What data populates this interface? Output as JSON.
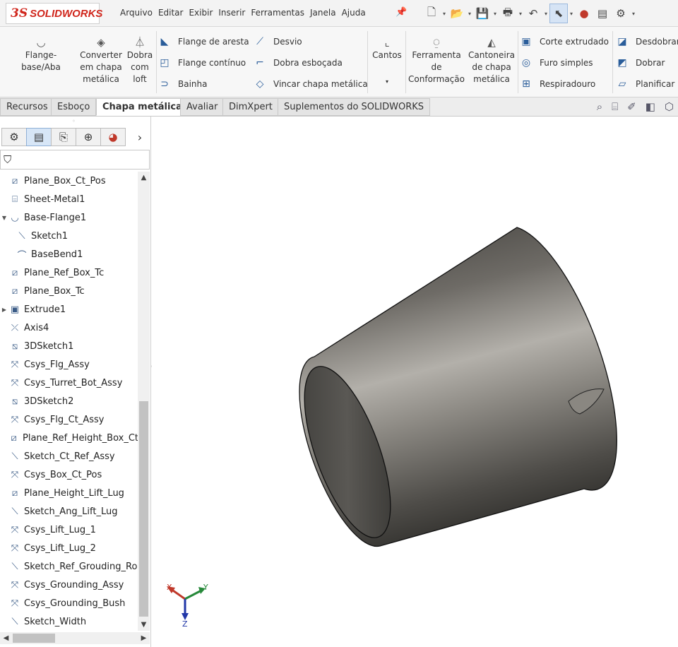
{
  "app": {
    "logo_mark": "3S",
    "logo_name": "SOLIDWORKS"
  },
  "menu": [
    "Arquivo",
    "Editar",
    "Exibir",
    "Inserir",
    "Ferramentas",
    "Janela",
    "Ajuda"
  ],
  "quick_access_icons": [
    "new-document-icon",
    "open-icon",
    "save-icon",
    "print-icon",
    "undo-icon",
    "select-icon",
    "rebuild-icon",
    "file-properties-icon",
    "options-icon"
  ],
  "ribbon": {
    "big_buttons": [
      {
        "name": "flange-base-aba",
        "label": "Flange-base/Aba",
        "icon": "base-flange-icon"
      },
      {
        "name": "converter-chapa",
        "label": "Converter em chapa metálica",
        "icon": "convert-to-sheet-metal-icon"
      },
      {
        "name": "dobra-com-loft",
        "label": "Dobra com loft",
        "icon": "lofted-bend-icon"
      },
      {
        "name": "cantos",
        "label": "Cantos",
        "icon": "corners-icon"
      },
      {
        "name": "ferramenta-conformacao",
        "label": "Ferramenta de Conformação",
        "icon": "forming-tool-icon"
      },
      {
        "name": "cantoneira",
        "label": "Cantoneira de chapa metálica",
        "icon": "sheet-metal-gusset-icon"
      }
    ],
    "col1": [
      "Flange de aresta",
      "Flange contínuo",
      "Bainha"
    ],
    "col2": [
      "Desvio",
      "Dobra esboçada",
      "Vincar chapa metálica"
    ],
    "col3": [
      "Corte extrudado",
      "Furo simples",
      "Respiradouro"
    ],
    "col4": [
      "Desdobrar",
      "Dobrar",
      "Planificar"
    ]
  },
  "tabs": [
    "Recursos",
    "Esboço",
    "Chapa metálica",
    "Avaliar",
    "DimXpert",
    "Suplementos do SOLIDWORKS"
  ],
  "active_tab": "Chapa metálica",
  "view_icons": [
    "zoom-to-fit-icon",
    "zoom-to-area-icon",
    "previous-view-icon",
    "section-view-icon",
    "view-orientation-icon"
  ],
  "panel_tabs": [
    "feature-manager-icon",
    "property-manager-icon",
    "configuration-manager-icon",
    "dimxpert-manager-icon",
    "display-manager-icon"
  ],
  "tree": [
    {
      "label": "Plane_Box_Ct_Pos",
      "icon": "plane-icon",
      "indent": 0
    },
    {
      "label": "Sheet-Metal1",
      "icon": "sheet-metal-icon",
      "indent": 0
    },
    {
      "label": "Base-Flange1",
      "icon": "base-flange-icon",
      "indent": 0,
      "expanded": true
    },
    {
      "label": "Sketch1",
      "icon": "sketch-icon",
      "indent": 1
    },
    {
      "label": "BaseBend1",
      "icon": "bend-icon",
      "indent": 1
    },
    {
      "label": "Plane_Ref_Box_Tc",
      "icon": "plane-icon",
      "indent": 0
    },
    {
      "label": "Plane_Box_Tc",
      "icon": "plane-icon",
      "indent": 0
    },
    {
      "label": "Extrude1",
      "icon": "extrude-icon",
      "indent": 0,
      "collapsed": true
    },
    {
      "label": "Axis4",
      "icon": "axis-icon",
      "indent": 0
    },
    {
      "label": "3DSketch1",
      "icon": "sketch3d-icon",
      "indent": 0
    },
    {
      "label": "Csys_Flg_Assy",
      "icon": "csys-icon",
      "indent": 0
    },
    {
      "label": "Csys_Turret_Bot_Assy",
      "icon": "csys-icon",
      "indent": 0
    },
    {
      "label": "3DSketch2",
      "icon": "sketch3d-icon",
      "indent": 0
    },
    {
      "label": "Csys_Flg_Ct_Assy",
      "icon": "csys-icon",
      "indent": 0
    },
    {
      "label": "Plane_Ref_Height_Box_Ct",
      "icon": "plane-icon",
      "indent": 0
    },
    {
      "label": "Sketch_Ct_Ref_Assy",
      "icon": "sketch-icon",
      "indent": 0
    },
    {
      "label": "Csys_Box_Ct_Pos",
      "icon": "csys-icon",
      "indent": 0
    },
    {
      "label": "Plane_Height_Lift_Lug",
      "icon": "plane-icon",
      "indent": 0
    },
    {
      "label": "Sketch_Ang_Lift_Lug",
      "icon": "sketch-icon",
      "indent": 0
    },
    {
      "label": "Csys_Lift_Lug_1",
      "icon": "csys-icon",
      "indent": 0
    },
    {
      "label": "Csys_Lift_Lug_2",
      "icon": "csys-icon",
      "indent": 0
    },
    {
      "label": "Sketch_Ref_Grouding_Ro",
      "icon": "sketch-icon",
      "indent": 0
    },
    {
      "label": "Csys_Grounding_Assy",
      "icon": "csys-icon",
      "indent": 0
    },
    {
      "label": "Csys_Grounding_Bush",
      "icon": "csys-icon",
      "indent": 0
    },
    {
      "label": "Sketch_Width",
      "icon": "sketch-icon",
      "indent": 0
    }
  ],
  "triad": {
    "x": "X",
    "y": "Y",
    "z": "Z"
  },
  "colors": {
    "brand": "#d0261c",
    "active_tab_bg": "#ffffff",
    "triad_x": "#c0392b",
    "triad_y": "#27893a",
    "triad_z": "#2238a8"
  }
}
